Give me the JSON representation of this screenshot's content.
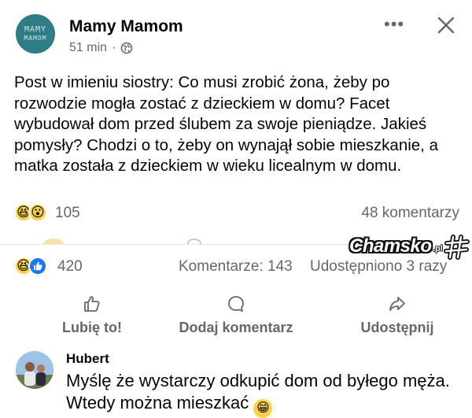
{
  "post": {
    "page_name": "Mamy Mamom",
    "avatar_line1": "MAMY",
    "avatar_line2": "MAMOM",
    "time": "51 min",
    "separator": "·",
    "more_icon": "more-dots-icon",
    "close_icon": "close-icon",
    "audience_icon": "globe-icon",
    "text": "Post w imieniu siostry:  Co musi zrobić żona, żeby po rozwodzie mogła zostać z dzieckiem w domu? Facet wybudował dom przed ślubem za swoje pieniądze. Jakieś pomysły? Chodzi o to, żeby on wynajął sobie mieszkanie, a matka została z dzieckiem w wieku licealnym w domu."
  },
  "shared_reactions": {
    "icons": [
      "haha-reaction-icon",
      "wow-reaction-icon"
    ],
    "count": "105",
    "comments": "48 komentarzy"
  },
  "watermark": {
    "text": "Chamsko",
    "suffix": ".pl"
  },
  "reactions": {
    "icons": [
      "haha-reaction-icon",
      "like-reaction-icon"
    ],
    "count": "420",
    "comments": "Komentarze: 143",
    "shares": "Udostępniono 3 razy"
  },
  "actions": {
    "like": "Lubię to!",
    "comment": "Dodaj komentarz",
    "share": "Udostępnij"
  },
  "comment": {
    "author": "Hubert",
    "text": "Myślę że wystarczy odkupić dom od byłego męża. Wtedy można mieszkać"
  },
  "colors": {
    "text": "#050505",
    "secondary": "#65676b",
    "like_blue": "#1877f2",
    "emoji_yellow": "#fbd24b",
    "avatar_teal": "#2f7d86"
  }
}
